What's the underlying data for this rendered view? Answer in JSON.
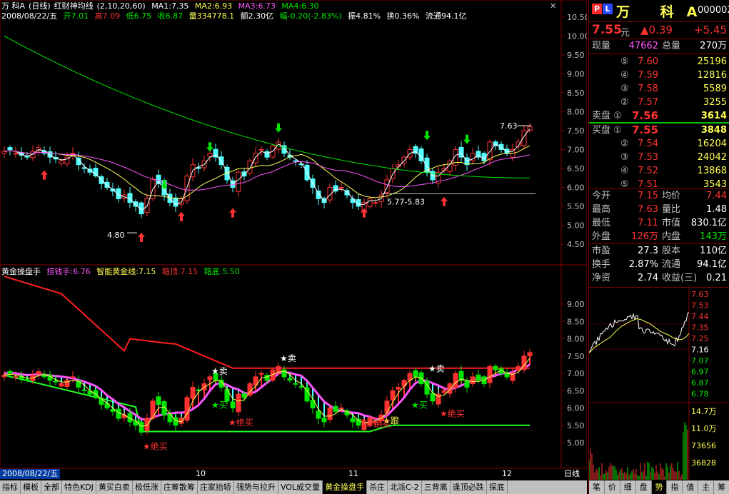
{
  "title": {
    "stock": "万 科A",
    "period": "(日线)",
    "indicator": "红财神均线",
    "params": "(2,10,20,60)",
    "ma1": "MA1:7.35",
    "ma2": "MA2:6.93",
    "ma3": "MA3:6.73",
    "ma4": "MA4:6.30"
  },
  "info": {
    "date": "2008/08/22/五",
    "open": "开7.01",
    "high": "高7.09",
    "low": "低6.75",
    "close": "收6.87",
    "vol": "量334778.1",
    "amount": "额2.30亿",
    "change": "幅-0.20(-2.83%)",
    "amp": "振4.81%",
    "turn": "换0.36%",
    "float": "流通94.1亿"
  },
  "indicator": {
    "name": "黄金操盘手",
    "a": "捞钱手:6.76",
    "b": "智能黄金线:7.15",
    "c": "箱顶:7.15",
    "d": "箱底:5.50"
  },
  "colors": {
    "up": "#ff3232",
    "down": "#54ffff",
    "ma1": "#ffffff",
    "ma2": "#ffff54",
    "ma3": "#ff54ff",
    "ma4": "#00e600",
    "grid": "#800000",
    "box_top": "#ff2020",
    "box_bottom": "#20ff20"
  },
  "main_axis": {
    "labels": [
      "10.50",
      "10.00",
      "9.50",
      "9.00",
      "8.50",
      "8.00",
      "7.50",
      "7.00",
      "6.50",
      "6.00",
      "5.50",
      "5.00",
      "4.50"
    ]
  },
  "ind_axis": {
    "labels": [
      "9.00",
      "8.50",
      "8.00",
      "7.50",
      "7.00",
      "6.50",
      "6.00",
      "5.50",
      "5.00"
    ]
  },
  "annotations": {
    "low_label": "4.80",
    "box_label": "5.77-5.83",
    "high_label": "7.63"
  },
  "signals": [
    "卖",
    "卖",
    "卖",
    "买",
    "绝买",
    "买",
    "绝买",
    "绝买",
    "跟",
    "买",
    "绝买"
  ],
  "x_dates": [
    "10",
    "11",
    "12"
  ],
  "date_tag": "2008/08/22/五",
  "period_tag": "日线",
  "tabs": [
    "指标",
    "模板",
    "全部",
    "特色KDJ",
    "黄买白卖",
    "极低涨",
    "庄筹散筹",
    "庄家抬轿",
    "强势与拉升",
    "VOL成交量",
    "黄金操盘手",
    "杀庄",
    "北派C-2",
    "三背离",
    "逢顶必跌",
    "探底"
  ],
  "active_tab": "黄金操盘手",
  "quote": {
    "name": "万 科A",
    "code": "000002",
    "price": "7.55",
    "yuan": "元",
    "change": "▲0.39",
    "change_pct": "+5.45",
    "xianliang_label": "现量",
    "xianliang": "47662",
    "zongliang_label": "总量",
    "zongliang": "270万",
    "sell": [
      {
        "label": "⑤",
        "price": "7.60",
        "vol": "25196"
      },
      {
        "label": "④",
        "price": "7.59",
        "vol": "12816"
      },
      {
        "label": "③",
        "price": "7.58",
        "vol": "5589"
      },
      {
        "label": "②",
        "price": "7.57",
        "vol": "3255"
      },
      {
        "label": "卖盘 ①",
        "price": "7.56",
        "vol": "3614"
      }
    ],
    "buy": [
      {
        "label": "买盘 ①",
        "price": "7.55",
        "vol": "3848"
      },
      {
        "label": "②",
        "price": "7.54",
        "vol": "16204"
      },
      {
        "label": "③",
        "price": "7.53",
        "vol": "24042"
      },
      {
        "label": "④",
        "price": "7.52",
        "vol": "13868"
      },
      {
        "label": "⑤",
        "price": "7.51",
        "vol": "3543"
      }
    ],
    "stats": [
      {
        "l1": "今开",
        "v1": "7.15",
        "c1": "red",
        "l2": "均价",
        "v2": "7.44",
        "c2": "red"
      },
      {
        "l1": "最高",
        "v1": "7.63",
        "c1": "red",
        "l2": "量比",
        "v2": "1.48",
        "c2": "white"
      },
      {
        "l1": "最低",
        "v1": "7.11",
        "c1": "red",
        "l2": "市值",
        "v2": "830.1亿",
        "c2": "white"
      },
      {
        "l1": "外盘",
        "v1": "126万",
        "c1": "red",
        "l2": "内盘",
        "v2": "143万",
        "c2": "green"
      }
    ],
    "fund": [
      {
        "l1": "市盈",
        "v1": "27.3",
        "l2": "股本",
        "v2": "110亿"
      },
      {
        "l1": "换手",
        "v1": "2.87%",
        "l2": "流通",
        "v2": "94.1亿"
      },
      {
        "l1": "净资",
        "v1": "2.74",
        "l2": "收益(三)",
        "v2": "0.21"
      }
    ]
  },
  "mini": {
    "price_labels": [
      "7.63",
      "7.53",
      "7.44",
      "7.35",
      "7.25",
      "7.16",
      "7.07",
      "6.97",
      "6.87",
      "6.78"
    ],
    "vol_labels": [
      "14.7万",
      "11.0万",
      "73656",
      "36828"
    ],
    "tabs": [
      "笔",
      "价",
      "细",
      "盘",
      "势",
      "指",
      "值",
      "主",
      "筹"
    ],
    "active_tab": "势"
  },
  "chart_data": {
    "type": "candlestick",
    "title": "",
    "xlabel": "",
    "ylabel": "",
    "ylim": [
      4.3,
      10.8
    ],
    "close": [
      6.95,
      7.0,
      6.9,
      6.85,
      6.8,
      6.95,
      7.05,
      6.9,
      6.8,
      6.75,
      6.7,
      6.8,
      6.9,
      6.6,
      6.5,
      6.4,
      6.3,
      6.1,
      6.0,
      5.9,
      5.7,
      5.8,
      5.6,
      5.5,
      5.3,
      5.7,
      6.2,
      6.1,
      5.8,
      5.6,
      5.5,
      5.7,
      6.3,
      6.6,
      6.5,
      6.7,
      6.9,
      6.8,
      6.6,
      6.2,
      6.0,
      6.4,
      6.3,
      6.7,
      6.9,
      7.0,
      6.8,
      7.1,
      7.2,
      6.9,
      6.8,
      6.7,
      6.6,
      6.2,
      6.0,
      5.7,
      5.6,
      6.0,
      5.9,
      6.0,
      5.8,
      5.6,
      5.5,
      5.6,
      5.7,
      5.6,
      5.8,
      6.2,
      6.5,
      6.6,
      6.8,
      7.0,
      6.9,
      6.7,
      6.4,
      6.2,
      6.4,
      6.5,
      6.7,
      7.0,
      6.8,
      6.6,
      6.9,
      6.8,
      6.7,
      7.2,
      7.1,
      7.0,
      6.9,
      7.0,
      7.2,
      7.5,
      7.6
    ],
    "ma_labels": [
      "MA1:7.35",
      "MA2:6.93",
      "MA3:6.73",
      "MA4:6.30"
    ]
  }
}
